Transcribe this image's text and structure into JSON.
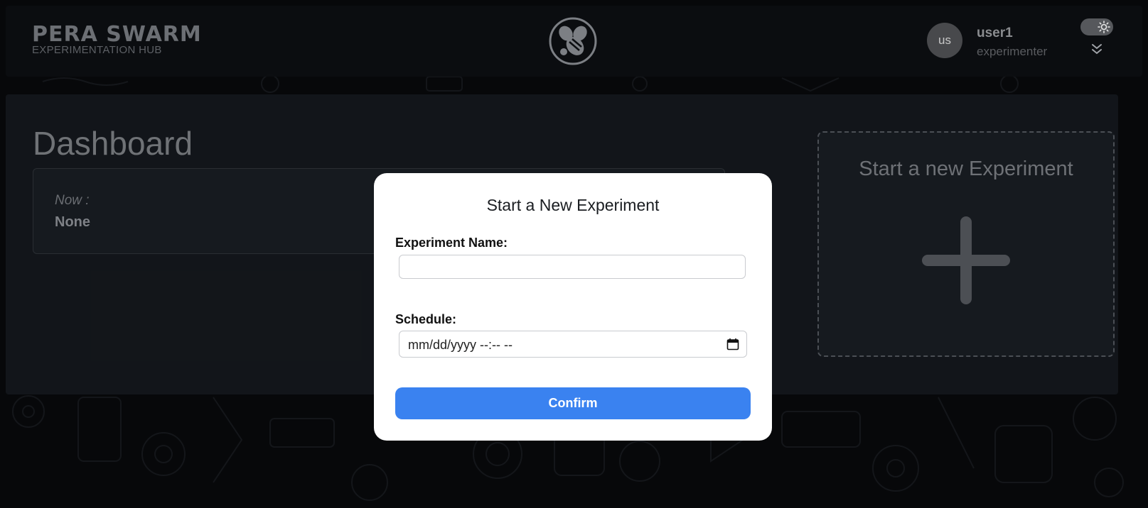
{
  "header": {
    "brand_title": "PERA SWARM",
    "brand_subtitle": "EXPERIMENTATION HUB",
    "logo_icon": "bee-icon",
    "user": {
      "avatar_initials": "us",
      "name": "user1",
      "role": "experimenter"
    },
    "theme_toggle_icon": "sun-icon",
    "menu_icon": "double-chevron-down-icon"
  },
  "dashboard": {
    "title": "Dashboard",
    "current_experiment": {
      "label": "Now :",
      "value": "None"
    },
    "new_experiment_card": {
      "title": "Start a new Experiment",
      "icon": "plus-icon"
    }
  },
  "modal": {
    "title": "Start a New Experiment",
    "name_label": "Experiment Name:",
    "name_value": "",
    "schedule_label": "Schedule:",
    "schedule_placeholder": "mm/dd/yyyy --:-- --",
    "confirm_label": "Confirm"
  },
  "colors": {
    "background": "#0b0d10",
    "confirm_button": "#3a82f0",
    "modal_background": "#ffffff"
  }
}
